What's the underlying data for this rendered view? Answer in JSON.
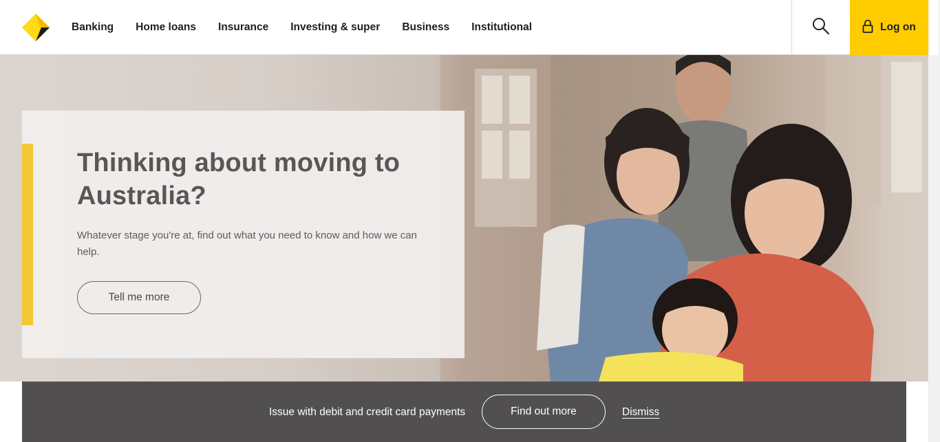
{
  "header": {
    "nav": [
      "Banking",
      "Home loans",
      "Insurance",
      "Investing & super",
      "Business",
      "Institutional"
    ],
    "logon_label": "Log on"
  },
  "hero": {
    "title": "Thinking about moving to Australia?",
    "body": "Whatever stage you're at, find out what you need to know and how we can help.",
    "cta_label": "Tell me more"
  },
  "alert": {
    "message": "Issue with debit and credit card payments",
    "cta_label": "Find out more",
    "dismiss_label": "Dismiss"
  },
  "colors": {
    "brand_yellow": "#ffcc00",
    "accent_bar": "#f2c834",
    "alert_bg": "#524f51",
    "title_text": "#5a5656"
  },
  "icons": {
    "logo": "diamond-logo-icon",
    "search": "search-icon",
    "lock": "lock-icon"
  }
}
